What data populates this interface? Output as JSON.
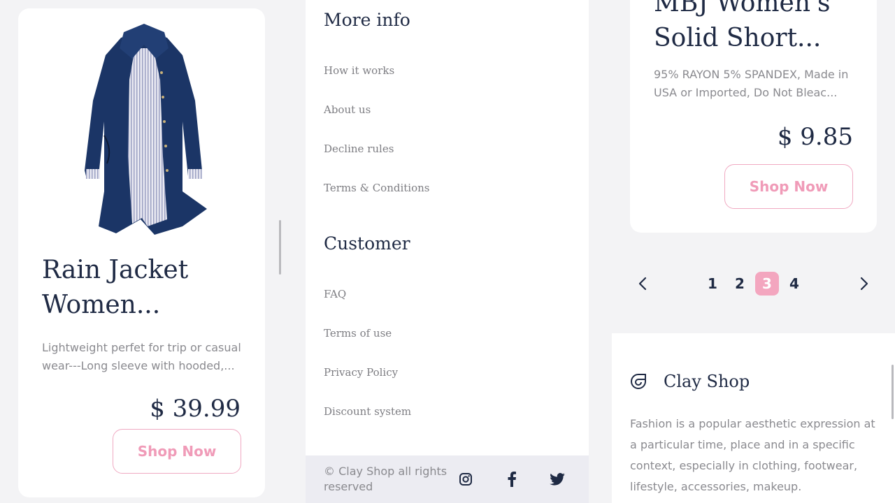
{
  "left_card": {
    "title_line1": "Rain Jacket",
    "title_line2": "Women...",
    "description": "Lightweight perfet for trip or casual wear---Long sleeve with hooded,...",
    "price": "$ 39.99",
    "button": "Shop Now"
  },
  "more_info": {
    "title": "More info",
    "links": [
      "How it works",
      "About us",
      "Decline rules",
      "Terms & Conditions"
    ]
  },
  "customer": {
    "title": "Customer",
    "links": [
      "FAQ",
      "Terms of use",
      "Privacy Policy",
      "Discount system"
    ]
  },
  "footer": {
    "copyright": "© Clay Shop all rights reserved",
    "social": [
      "instagram-icon",
      "facebook-icon",
      "twitter-icon"
    ]
  },
  "right_card": {
    "title_line1": "MBJ Women's",
    "title_line2": "Solid Short...",
    "description": "95% RAYON 5% SPANDEX, Made in USA or Imported, Do Not Bleac...",
    "price": "$ 9.85",
    "button": "Shop Now"
  },
  "pagination": {
    "pages": [
      "1",
      "2",
      "3",
      "4"
    ],
    "active": "3"
  },
  "about": {
    "brand": "Clay Shop",
    "text": "Fashion is a popular aesthetic expression at a particular time, place and in a specific context, especially in clothing, footwear, lifestyle, accessories, makeup."
  },
  "colors": {
    "accent": "#f3a6bf",
    "text_dark": "#1f2a44",
    "text_muted": "#8a8a8f"
  }
}
